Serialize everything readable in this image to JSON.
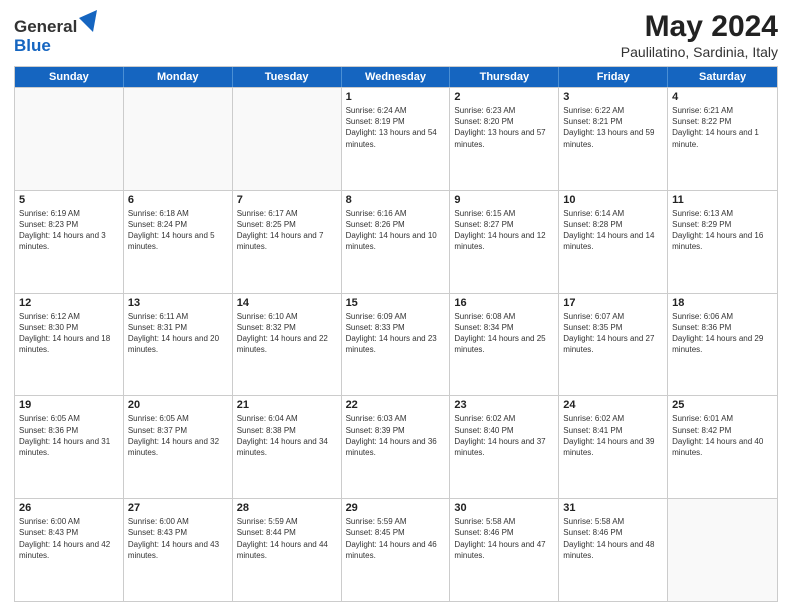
{
  "header": {
    "logo_general": "General",
    "logo_blue": "Blue",
    "title": "May 2024",
    "subtitle": "Paulilatino, Sardinia, Italy"
  },
  "calendar": {
    "days_of_week": [
      "Sunday",
      "Monday",
      "Tuesday",
      "Wednesday",
      "Thursday",
      "Friday",
      "Saturday"
    ],
    "weeks": [
      [
        {
          "day": "",
          "empty": true
        },
        {
          "day": "",
          "empty": true
        },
        {
          "day": "",
          "empty": true
        },
        {
          "day": "1",
          "sunrise": "6:24 AM",
          "sunset": "8:19 PM",
          "daylight": "13 hours and 54 minutes."
        },
        {
          "day": "2",
          "sunrise": "6:23 AM",
          "sunset": "8:20 PM",
          "daylight": "13 hours and 57 minutes."
        },
        {
          "day": "3",
          "sunrise": "6:22 AM",
          "sunset": "8:21 PM",
          "daylight": "13 hours and 59 minutes."
        },
        {
          "day": "4",
          "sunrise": "6:21 AM",
          "sunset": "8:22 PM",
          "daylight": "14 hours and 1 minute."
        }
      ],
      [
        {
          "day": "5",
          "sunrise": "6:19 AM",
          "sunset": "8:23 PM",
          "daylight": "14 hours and 3 minutes."
        },
        {
          "day": "6",
          "sunrise": "6:18 AM",
          "sunset": "8:24 PM",
          "daylight": "14 hours and 5 minutes."
        },
        {
          "day": "7",
          "sunrise": "6:17 AM",
          "sunset": "8:25 PM",
          "daylight": "14 hours and 7 minutes."
        },
        {
          "day": "8",
          "sunrise": "6:16 AM",
          "sunset": "8:26 PM",
          "daylight": "14 hours and 10 minutes."
        },
        {
          "day": "9",
          "sunrise": "6:15 AM",
          "sunset": "8:27 PM",
          "daylight": "14 hours and 12 minutes."
        },
        {
          "day": "10",
          "sunrise": "6:14 AM",
          "sunset": "8:28 PM",
          "daylight": "14 hours and 14 minutes."
        },
        {
          "day": "11",
          "sunrise": "6:13 AM",
          "sunset": "8:29 PM",
          "daylight": "14 hours and 16 minutes."
        }
      ],
      [
        {
          "day": "12",
          "sunrise": "6:12 AM",
          "sunset": "8:30 PM",
          "daylight": "14 hours and 18 minutes."
        },
        {
          "day": "13",
          "sunrise": "6:11 AM",
          "sunset": "8:31 PM",
          "daylight": "14 hours and 20 minutes."
        },
        {
          "day": "14",
          "sunrise": "6:10 AM",
          "sunset": "8:32 PM",
          "daylight": "14 hours and 22 minutes."
        },
        {
          "day": "15",
          "sunrise": "6:09 AM",
          "sunset": "8:33 PM",
          "daylight": "14 hours and 23 minutes."
        },
        {
          "day": "16",
          "sunrise": "6:08 AM",
          "sunset": "8:34 PM",
          "daylight": "14 hours and 25 minutes."
        },
        {
          "day": "17",
          "sunrise": "6:07 AM",
          "sunset": "8:35 PM",
          "daylight": "14 hours and 27 minutes."
        },
        {
          "day": "18",
          "sunrise": "6:06 AM",
          "sunset": "8:36 PM",
          "daylight": "14 hours and 29 minutes."
        }
      ],
      [
        {
          "day": "19",
          "sunrise": "6:05 AM",
          "sunset": "8:36 PM",
          "daylight": "14 hours and 31 minutes."
        },
        {
          "day": "20",
          "sunrise": "6:05 AM",
          "sunset": "8:37 PM",
          "daylight": "14 hours and 32 minutes."
        },
        {
          "day": "21",
          "sunrise": "6:04 AM",
          "sunset": "8:38 PM",
          "daylight": "14 hours and 34 minutes."
        },
        {
          "day": "22",
          "sunrise": "6:03 AM",
          "sunset": "8:39 PM",
          "daylight": "14 hours and 36 minutes."
        },
        {
          "day": "23",
          "sunrise": "6:02 AM",
          "sunset": "8:40 PM",
          "daylight": "14 hours and 37 minutes."
        },
        {
          "day": "24",
          "sunrise": "6:02 AM",
          "sunset": "8:41 PM",
          "daylight": "14 hours and 39 minutes."
        },
        {
          "day": "25",
          "sunrise": "6:01 AM",
          "sunset": "8:42 PM",
          "daylight": "14 hours and 40 minutes."
        }
      ],
      [
        {
          "day": "26",
          "sunrise": "6:00 AM",
          "sunset": "8:43 PM",
          "daylight": "14 hours and 42 minutes."
        },
        {
          "day": "27",
          "sunrise": "6:00 AM",
          "sunset": "8:43 PM",
          "daylight": "14 hours and 43 minutes."
        },
        {
          "day": "28",
          "sunrise": "5:59 AM",
          "sunset": "8:44 PM",
          "daylight": "14 hours and 44 minutes."
        },
        {
          "day": "29",
          "sunrise": "5:59 AM",
          "sunset": "8:45 PM",
          "daylight": "14 hours and 46 minutes."
        },
        {
          "day": "30",
          "sunrise": "5:58 AM",
          "sunset": "8:46 PM",
          "daylight": "14 hours and 47 minutes."
        },
        {
          "day": "31",
          "sunrise": "5:58 AM",
          "sunset": "8:46 PM",
          "daylight": "14 hours and 48 minutes."
        },
        {
          "day": "",
          "empty": true
        }
      ]
    ]
  }
}
